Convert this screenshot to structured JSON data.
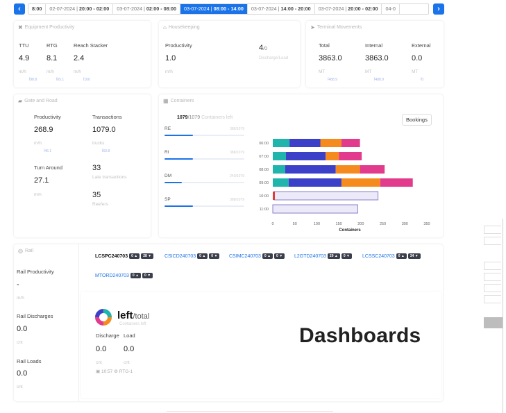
{
  "shift_bar": {
    "prev_icon": "chevron-left",
    "next_icon": "chevron-right",
    "shifts": [
      {
        "date": "",
        "time": "8:00",
        "active": false
      },
      {
        "date": "02-07-2024",
        "time": "20:00 - 02:00",
        "active": false
      },
      {
        "date": "03-07-2024",
        "time": "02:00 - 08:00",
        "active": false
      },
      {
        "date": "03-07-2024",
        "time": "08:00 - 14:00",
        "active": true
      },
      {
        "date": "03-07-2024",
        "time": "14:00 - 20:00",
        "active": false
      },
      {
        "date": "03-07-2024",
        "time": "20:00 - 02:00",
        "active": false
      },
      {
        "date": "04-0",
        "time": "",
        "active": false
      }
    ]
  },
  "equipment": {
    "title": "Equipment Productivity",
    "cols": [
      {
        "label": "TTU",
        "value": "4.9",
        "unit": "m/h",
        "sub": "Ϊ98.8"
      },
      {
        "label": "RTG",
        "value": "8.1",
        "unit": "m/h",
        "sub": "Ϊ65.1"
      },
      {
        "label": "Reach Stacker",
        "value": "2.4",
        "unit": "m/h",
        "sub": "Ϊ100"
      }
    ]
  },
  "housekeeping": {
    "title": "Housekeeping",
    "productivity_label": "Productivity",
    "productivity_value": "1.0",
    "unit": "m/h",
    "right_value": "4",
    "right_suffix": "/0",
    "right_sub": "Discharge/Load"
  },
  "terminal_movements": {
    "title": "Terminal Movements",
    "cols": [
      {
        "label": "Total",
        "value": "3863.0",
        "unit": "MT",
        "sub": "Ϊ488.9"
      },
      {
        "label": "Internal",
        "value": "3863.0",
        "unit": "MT",
        "sub": "Ϊ488.9"
      },
      {
        "label": "External",
        "value": "0.0",
        "unit": "MT",
        "sub": "Ϊ0"
      }
    ]
  },
  "gate": {
    "title": "Gate and Road",
    "productivity_label": "Productivity",
    "productivity_value": "268.9",
    "productivity_unit": "m/h",
    "productivity_sub": "Ϊ46.1",
    "transactions_label": "Transactions",
    "transactions_value": "1079.0",
    "transactions_unit": "trucks",
    "transactions_sub": "Ϊ69.8",
    "turnaround_label": "Turn Around",
    "turnaround_value": "27.1",
    "turnaround_unit": "mm",
    "late_value": "33",
    "late_label": "Late transactions",
    "reefers_value": "35",
    "reefers_label": "Reefers"
  },
  "containers": {
    "title": "Containers",
    "count": "1079",
    "total": "/1079",
    "caption": "Containers left",
    "bookings_label": "Bookings",
    "categories": [
      {
        "name": "RE",
        "count": "386/1079",
        "fraction": 0.36
      },
      {
        "name": "RI",
        "count": "388/1079",
        "fraction": 0.36
      },
      {
        "name": "DM",
        "count": "240/1079",
        "fraction": 0.22
      },
      {
        "name": "SP",
        "count": "388/1079",
        "fraction": 0.36
      }
    ]
  },
  "chart_data": {
    "type": "bar",
    "orientation": "horizontal",
    "stacked": true,
    "categories": [
      "06:00",
      "07:00",
      "08:00",
      "09:00",
      "10:00",
      "11:00"
    ],
    "series": [
      {
        "color": "#1fb5ad",
        "values": [
          38,
          30,
          28,
          36,
          3,
          0
        ]
      },
      {
        "color": "#3c3fc7",
        "values": [
          70,
          90,
          115,
          120,
          0,
          0
        ]
      },
      {
        "color": "#f58b1e",
        "values": [
          48,
          30,
          55,
          88,
          0,
          0
        ]
      },
      {
        "color": "#e23a8c",
        "values": [
          42,
          52,
          56,
          74,
          0,
          0
        ]
      },
      {
        "color": "#ece9f8",
        "values": [
          0,
          0,
          0,
          0,
          236,
          193
        ]
      }
    ],
    "xlabel": "Containers",
    "ylabel": "",
    "xticks": [
      0,
      50,
      100,
      150,
      200,
      250,
      300,
      350
    ],
    "xlim": [
      0,
      350
    ],
    "title": ""
  },
  "rail": {
    "title": "Rail",
    "productivity_label": "Rail Productivity",
    "productivity_value": "-",
    "productivity_unit": "m/h",
    "discharges_label": "Rail Discharges",
    "discharges_value": "0.0",
    "discharges_unit": "cnt",
    "loads_label": "Rail Loads",
    "loads_value": "0.0",
    "loads_unit": "cnt",
    "tabs": [
      {
        "name": "LCSPC240703",
        "up": "0",
        "down": "28"
      },
      {
        "name": "CSICD240703",
        "up": "0",
        "down": "0"
      },
      {
        "name": "CSIMC240703",
        "up": "0",
        "down": "0"
      },
      {
        "name": "L2GTD240703",
        "up": "29",
        "down": "0"
      },
      {
        "name": "LCSSC240703",
        "up": "0",
        "down": "34"
      },
      {
        "name": "MTORD240703",
        "up": "0",
        "down": "0"
      }
    ],
    "detail": {
      "left_label": "left",
      "total_label": "/total",
      "caption": "Containers left",
      "discharge_label": "Discharge",
      "load_label": "Load",
      "discharge_value": "0.0",
      "load_value": "0.0",
      "discharge_unit": "cnt",
      "load_unit": "cnt",
      "time": "10:57",
      "equipment": "RTG-1"
    }
  },
  "overlay_label": "Dashboards"
}
